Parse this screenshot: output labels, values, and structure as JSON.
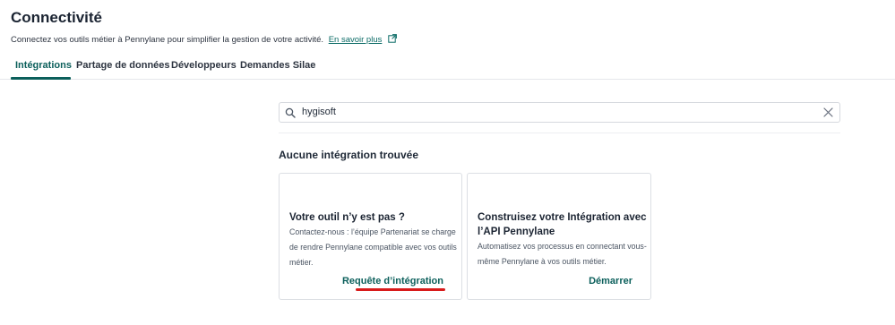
{
  "header": {
    "title": "Connectivité",
    "subtitle": "Connectez vos outils métier à Pennylane pour simplifier la gestion de votre activité.",
    "learn_more": "En savoir plus"
  },
  "tabs": [
    {
      "label": "Intégrations",
      "active": true
    },
    {
      "label": "Partage de données",
      "active": false
    },
    {
      "label": "Développeurs",
      "active": false
    },
    {
      "label": "Demandes Silae",
      "active": false
    }
  ],
  "search": {
    "value": "hygisoft"
  },
  "results": {
    "empty_message": "Aucune intégration trouvée"
  },
  "cards": [
    {
      "title": "Votre outil n’y est pas ?",
      "description": "Contactez-nous : l’équipe Partenariat se charge de rendre Pennylane compatible avec vos outils métier.",
      "action": "Requête d’intégration"
    },
    {
      "title": "Construisez votre Intégration avec l’API Pennylane",
      "description": "Automatisez vos processus en connectant vous-même Pennylane à vos outils métier.",
      "action": "Démarrer"
    }
  ],
  "colors": {
    "accent": "#0b5f5b",
    "annotation": "#d81b1b"
  },
  "icons": {
    "external_link": "external-link-icon",
    "search": "search-icon",
    "clear": "close-icon"
  }
}
